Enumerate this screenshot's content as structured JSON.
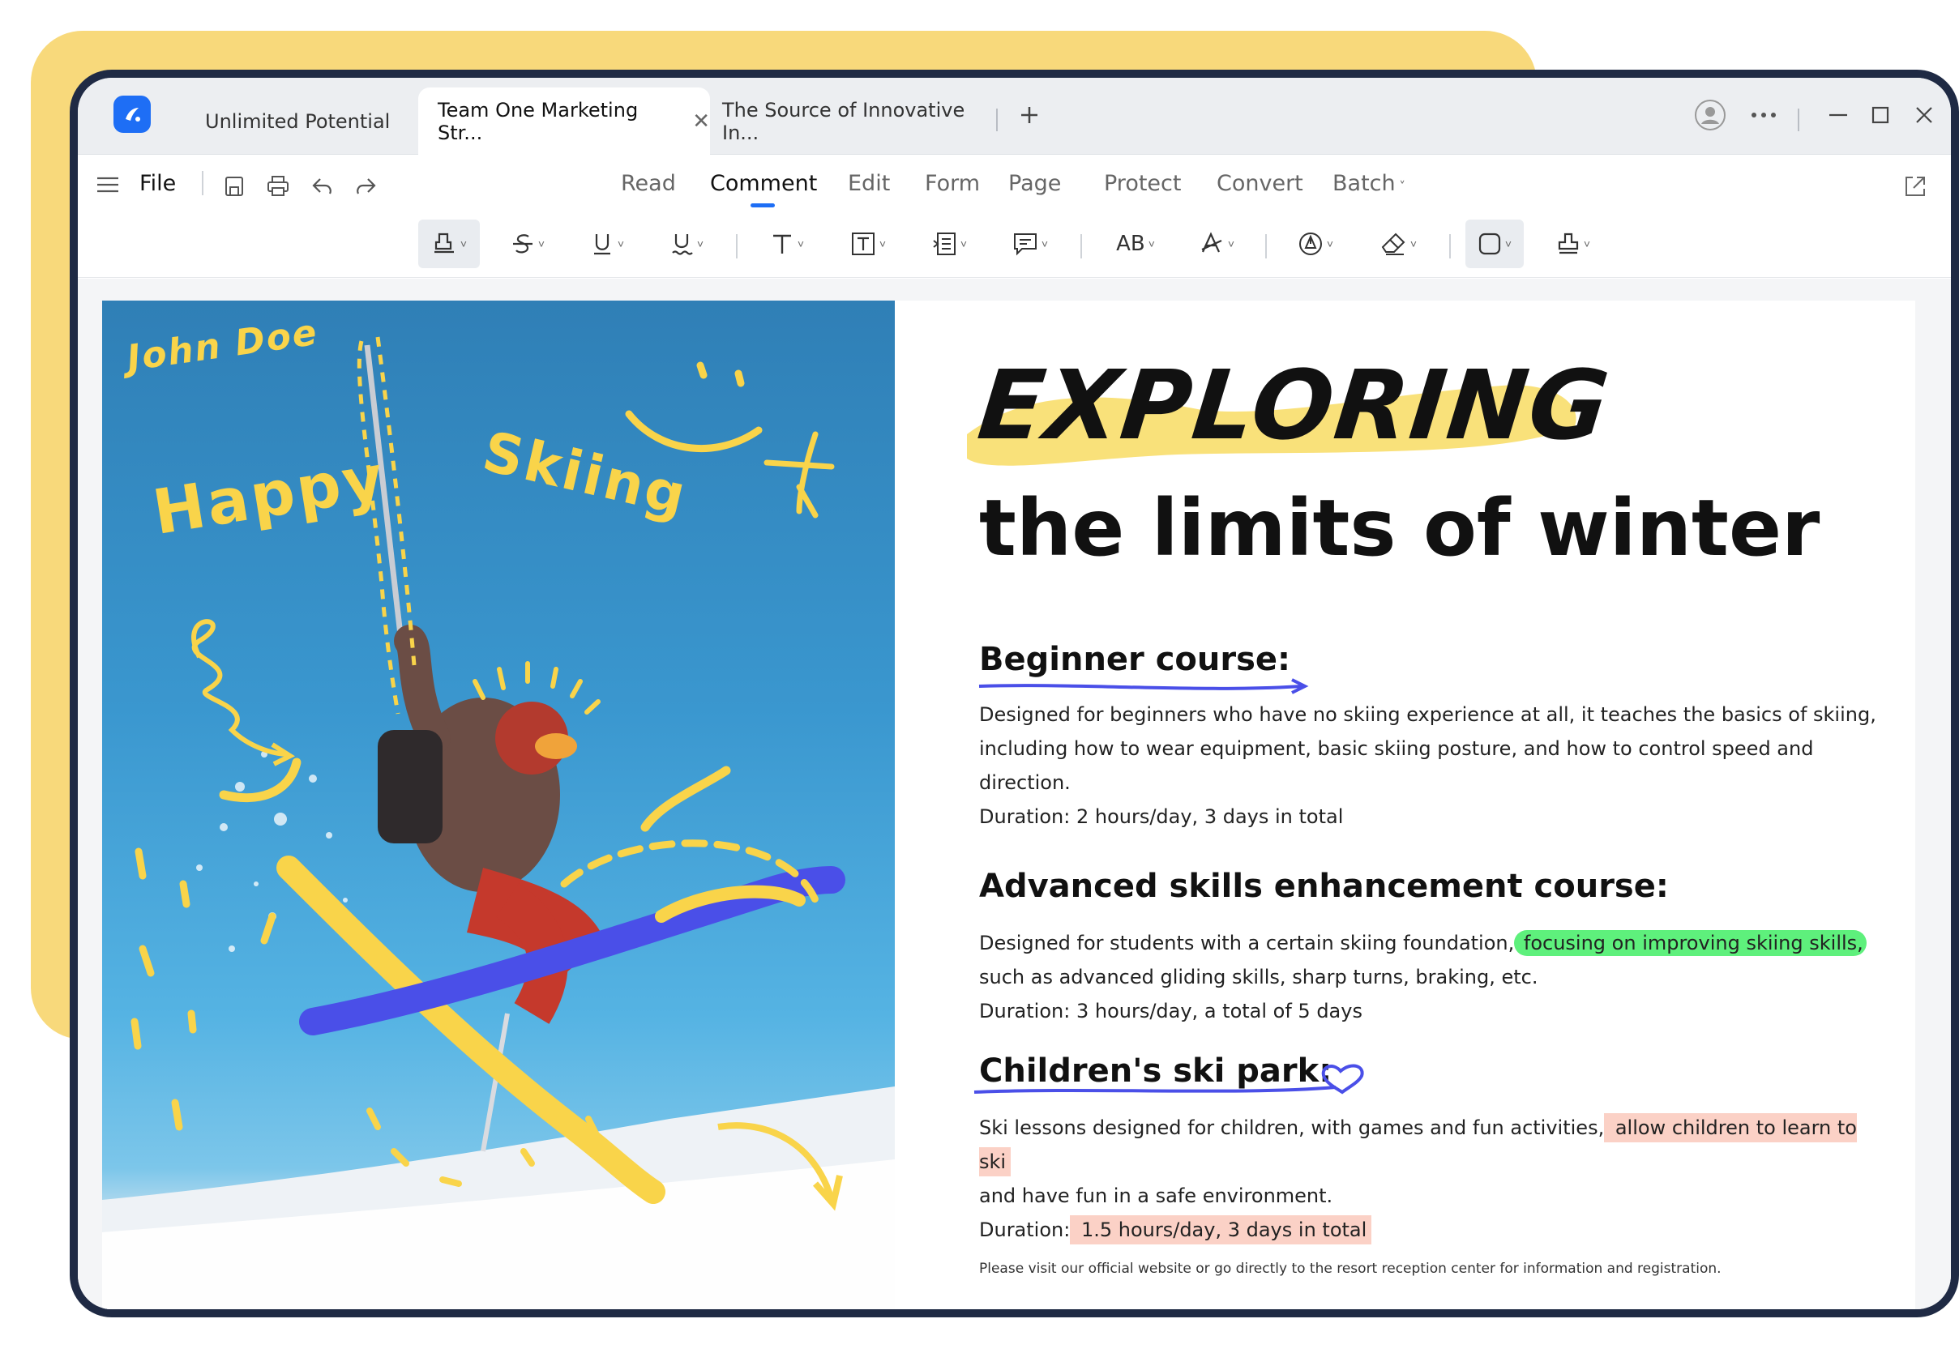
{
  "tabs": [
    {
      "label": "Unlimited Potential",
      "active": false
    },
    {
      "label": "Team One Marketing Str...",
      "active": true
    },
    {
      "label": "The Source of Innovative In...",
      "active": false
    }
  ],
  "menu": {
    "file_label": "File",
    "items": [
      "Read",
      "Comment",
      "Edit",
      "Form",
      "Page",
      "Protect",
      "Convert",
      "Batch"
    ],
    "active": "Comment"
  },
  "toolbar": {
    "tools": [
      "highlight-icon",
      "strikethrough-icon",
      "underline-icon",
      "squiggly-underline-icon",
      "text-icon",
      "text-box-icon",
      "text-callout-icon",
      "comment-icon",
      "ab-icon",
      "text-color-icon",
      "pen-icon",
      "eraser-icon",
      "shape-icon",
      "stamp-icon"
    ]
  },
  "document": {
    "photo_annotations": {
      "name": "John Doe",
      "happy": "Happy",
      "skiing": "Skiing"
    },
    "title_main": "EXPLORING",
    "title_sub": "the limits of winter",
    "sections": [
      {
        "heading": "Beginner course:",
        "lines": [
          "Designed for beginners who have no skiing experience at all, it teaches the basics of skiing,",
          "including how to wear equipment, basic skiing posture, and how to control speed and",
          "direction.",
          "Duration: 2 hours/day, 3 days in total"
        ]
      },
      {
        "heading": "Advanced skills enhancement course:",
        "line1_pre": "Designed for students with a certain skiing foundation,",
        "line1_highlight": " focusing on improving skiing skills,",
        "line2": "such as advanced gliding skills, sharp turns, braking, etc.",
        "line3": "Duration: 3 hours/day, a total of 5 days"
      },
      {
        "heading": "Children's ski park:",
        "line1_pre": "Ski lessons designed for children, with games and fun activities,",
        "line1_highlight": " allow children to learn to ski",
        "line2": "and have fun in a safe environment.",
        "line3_pre": "Duration:",
        "line3_highlight": " 1.5 hours/day, 3 days in total"
      }
    ],
    "footer": "Please visit our official website or go directly to the resort reception center for information and registration."
  },
  "colors": {
    "accent": "#1e6ef5",
    "backdrop": "#f8d97b",
    "frame": "#1f2a44",
    "highlight_green": "#5ef07c",
    "highlight_pink": "#fbd1c6",
    "ink_blue": "#4a4fe8",
    "ink_yellow": "#f9d44a"
  }
}
